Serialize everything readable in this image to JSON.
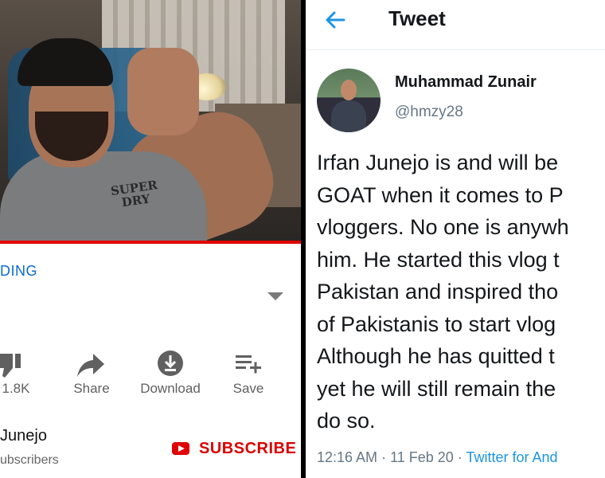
{
  "youtube": {
    "progress": 1.0,
    "shirt_logo": "SUPER\nDRY",
    "trending_label": "DING",
    "actions": [
      {
        "label": "1.8K",
        "icon": "dislike-icon"
      },
      {
        "label": "Share",
        "icon": "share-icon"
      },
      {
        "label": "Download",
        "icon": "download-icon"
      },
      {
        "label": "Save",
        "icon": "playlist-add-icon"
      }
    ],
    "channel_name": "Junejo",
    "subscribers_label": "ubscribers",
    "subscribe_label": "SUBSCRIBE",
    "accent_color": "#e00000",
    "link_color": "#0b6bd0"
  },
  "tweet": {
    "header_title": "Tweet",
    "back_icon": "back-arrow-icon",
    "display_name": "Muhammad Zunair",
    "handle": "@hmzy28",
    "text": "Irfan Junejo is and will be\nGOAT when it comes to P\nvloggers. No one is anywh\nhim. He started this vlog t\nPakistan and inspired tho\nof Pakistanis to start vlog\nAlthough he has quitted t\nyet he will still remain the\ndo so.",
    "time": "12:16 AM",
    "date": "11 Feb 20",
    "separator": " · ",
    "source": "Twitter for And",
    "accent_color": "#1b95e0"
  }
}
